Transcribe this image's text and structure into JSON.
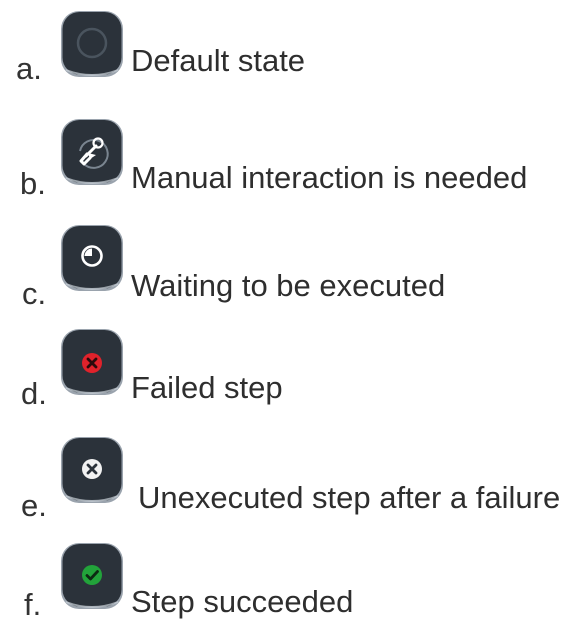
{
  "legend": [
    {
      "letter": "a.",
      "label": "Default state",
      "icon": "empty-ring-icon",
      "badge_color": ""
    },
    {
      "letter": "b.",
      "label": "Manual interaction is needed",
      "icon": "hand-pointer-icon",
      "badge_color": ""
    },
    {
      "letter": "c.",
      "label": "Waiting to be executed",
      "icon": "clock-icon",
      "badge_color": "#ffffff"
    },
    {
      "letter": "d.",
      "label": "Failed step",
      "icon": "error-x-icon",
      "badge_color": "#e0222b"
    },
    {
      "letter": "e.",
      "label": "Unexecuted step after a failure",
      "icon": "skipped-x-icon",
      "badge_color": "#ffffff"
    },
    {
      "letter": "f.",
      "label": "Step succeeded",
      "icon": "check-icon",
      "badge_color": "#22a33a"
    }
  ],
  "colors": {
    "tile_bg": "#2b323a",
    "tile_edge": "#a7b0ba",
    "ring": "#48525c",
    "text": "#2e2e2e"
  }
}
